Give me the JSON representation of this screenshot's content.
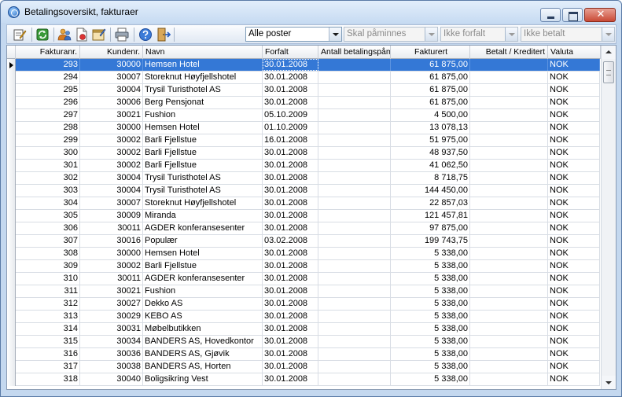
{
  "window": {
    "title": "Betalingsoversikt, fakturaer",
    "close_glyph": "✕"
  },
  "toolbar": {
    "icons": [
      "edit-icon",
      "refresh-icon",
      "users-icon",
      "document-icon",
      "properties-icon",
      "print-icon",
      "help-icon",
      "exit-icon"
    ]
  },
  "filters": {
    "records": "Alle poster",
    "reminders": "Skal påminnes",
    "due": "Ikke forfalt",
    "paid": "Ikke betalt"
  },
  "columns": {
    "invoice_no": "Fakturanr.",
    "customer_no": "Kundenr.",
    "name": "Navn",
    "due_date": "Forfalt",
    "reminder_count": "Antall betalingspåm",
    "invoiced": "Fakturert",
    "paid": "Betalt / Kreditert",
    "currency": "Valuta"
  },
  "rows": [
    {
      "invoice": "293",
      "customer": "30000",
      "name": "Hemsen Hotel",
      "due": "30.01.2008",
      "reminders": "",
      "invoiced": "61 875,00",
      "paid": "",
      "currency": "NOK"
    },
    {
      "invoice": "294",
      "customer": "30007",
      "name": "Storeknut Høyfjellshotel",
      "due": "30.01.2008",
      "reminders": "",
      "invoiced": "61 875,00",
      "paid": "",
      "currency": "NOK"
    },
    {
      "invoice": "295",
      "customer": "30004",
      "name": "Trysil Turisthotel AS",
      "due": "30.01.2008",
      "reminders": "",
      "invoiced": "61 875,00",
      "paid": "",
      "currency": "NOK"
    },
    {
      "invoice": "296",
      "customer": "30006",
      "name": "Berg Pensjonat",
      "due": "30.01.2008",
      "reminders": "",
      "invoiced": "61 875,00",
      "paid": "",
      "currency": "NOK"
    },
    {
      "invoice": "297",
      "customer": "30021",
      "name": "Fushion",
      "due": "05.10.2009",
      "reminders": "",
      "invoiced": "4 500,00",
      "paid": "",
      "currency": "NOK"
    },
    {
      "invoice": "298",
      "customer": "30000",
      "name": "Hemsen Hotel",
      "due": "01.10.2009",
      "reminders": "",
      "invoiced": "13 078,13",
      "paid": "",
      "currency": "NOK"
    },
    {
      "invoice": "299",
      "customer": "30002",
      "name": "Barli Fjellstue",
      "due": "16.01.2008",
      "reminders": "",
      "invoiced": "51 975,00",
      "paid": "",
      "currency": "NOK"
    },
    {
      "invoice": "300",
      "customer": "30002",
      "name": "Barli Fjellstue",
      "due": "30.01.2008",
      "reminders": "",
      "invoiced": "48 937,50",
      "paid": "",
      "currency": "NOK"
    },
    {
      "invoice": "301",
      "customer": "30002",
      "name": "Barli Fjellstue",
      "due": "30.01.2008",
      "reminders": "",
      "invoiced": "41 062,50",
      "paid": "",
      "currency": "NOK"
    },
    {
      "invoice": "302",
      "customer": "30004",
      "name": "Trysil Turisthotel AS",
      "due": "30.01.2008",
      "reminders": "",
      "invoiced": "8 718,75",
      "paid": "",
      "currency": "NOK"
    },
    {
      "invoice": "303",
      "customer": "30004",
      "name": "Trysil Turisthotel AS",
      "due": "30.01.2008",
      "reminders": "",
      "invoiced": "144 450,00",
      "paid": "",
      "currency": "NOK"
    },
    {
      "invoice": "304",
      "customer": "30007",
      "name": "Storeknut Høyfjellshotel",
      "due": "30.01.2008",
      "reminders": "",
      "invoiced": "22 857,03",
      "paid": "",
      "currency": "NOK"
    },
    {
      "invoice": "305",
      "customer": "30009",
      "name": "Miranda",
      "due": "30.01.2008",
      "reminders": "",
      "invoiced": "121 457,81",
      "paid": "",
      "currency": "NOK"
    },
    {
      "invoice": "306",
      "customer": "30011",
      "name": "AGDER konferansesenter",
      "due": "30.01.2008",
      "reminders": "",
      "invoiced": "97 875,00",
      "paid": "",
      "currency": "NOK"
    },
    {
      "invoice": "307",
      "customer": "30016",
      "name": "Populær",
      "due": "03.02.2008",
      "reminders": "",
      "invoiced": "199 743,75",
      "paid": "",
      "currency": "NOK"
    },
    {
      "invoice": "308",
      "customer": "30000",
      "name": "Hemsen Hotel",
      "due": "30.01.2008",
      "reminders": "",
      "invoiced": "5 338,00",
      "paid": "",
      "currency": "NOK"
    },
    {
      "invoice": "309",
      "customer": "30002",
      "name": "Barli Fjellstue",
      "due": "30.01.2008",
      "reminders": "",
      "invoiced": "5 338,00",
      "paid": "",
      "currency": "NOK"
    },
    {
      "invoice": "310",
      "customer": "30011",
      "name": "AGDER konferansesenter",
      "due": "30.01.2008",
      "reminders": "",
      "invoiced": "5 338,00",
      "paid": "",
      "currency": "NOK"
    },
    {
      "invoice": "311",
      "customer": "30021",
      "name": "Fushion",
      "due": "30.01.2008",
      "reminders": "",
      "invoiced": "5 338,00",
      "paid": "",
      "currency": "NOK"
    },
    {
      "invoice": "312",
      "customer": "30027",
      "name": "Dekko AS",
      "due": "30.01.2008",
      "reminders": "",
      "invoiced": "5 338,00",
      "paid": "",
      "currency": "NOK"
    },
    {
      "invoice": "313",
      "customer": "30029",
      "name": "KEBO AS",
      "due": "30.01.2008",
      "reminders": "",
      "invoiced": "5 338,00",
      "paid": "",
      "currency": "NOK"
    },
    {
      "invoice": "314",
      "customer": "30031",
      "name": "Møbelbutikken",
      "due": "30.01.2008",
      "reminders": "",
      "invoiced": "5 338,00",
      "paid": "",
      "currency": "NOK"
    },
    {
      "invoice": "315",
      "customer": "30034",
      "name": "BANDERS AS, Hovedkontor",
      "due": "30.01.2008",
      "reminders": "",
      "invoiced": "5 338,00",
      "paid": "",
      "currency": "NOK"
    },
    {
      "invoice": "316",
      "customer": "30036",
      "name": "BANDERS AS, Gjøvik",
      "due": "30.01.2008",
      "reminders": "",
      "invoiced": "5 338,00",
      "paid": "",
      "currency": "NOK"
    },
    {
      "invoice": "317",
      "customer": "30038",
      "name": "BANDERS AS, Horten",
      "due": "30.01.2008",
      "reminders": "",
      "invoiced": "5 338,00",
      "paid": "",
      "currency": "NOK"
    },
    {
      "invoice": "318",
      "customer": "30040",
      "name": "Boligsikring Vest",
      "due": "30.01.2008",
      "reminders": "",
      "invoiced": "5 338,00",
      "paid": "",
      "currency": "NOK"
    }
  ]
}
